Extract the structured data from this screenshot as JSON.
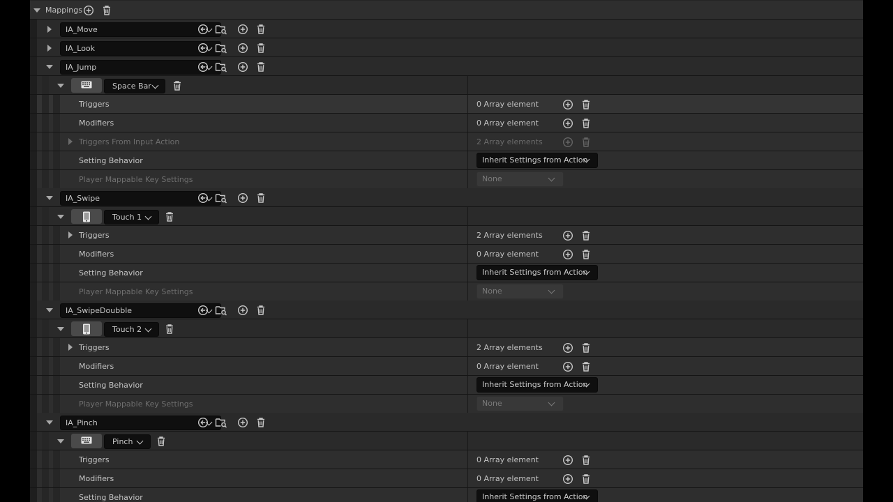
{
  "mappings": {
    "label": "Mappings"
  },
  "actions": [
    {
      "name": "IA_Move"
    },
    {
      "name": "IA_Look"
    },
    {
      "name": "IA_Jump"
    },
    {
      "name": "IA_Swipe"
    },
    {
      "name": "IA_SwipeDoubble"
    },
    {
      "name": "IA_Pinch"
    }
  ],
  "keys": {
    "jump": "Space Bar",
    "swipe": "Touch 1",
    "swipedouble": "Touch 2",
    "pinch": "Pinch"
  },
  "properties": {
    "triggers": "Triggers",
    "modifiers": "Modifiers",
    "triggers_from_action": "Triggers From Input Action",
    "setting_behavior": "Setting Behavior",
    "player_mappable": "Player Mappable Key Settings"
  },
  "values": {
    "zero_elements": "0 Array element",
    "two_elements": "2 Array elements",
    "inherit": "Inherit Settings from Action",
    "none": "None"
  },
  "icons": {
    "add": "add-icon",
    "delete": "trash-icon",
    "use_selected": "use-selected-arrow-icon",
    "browse": "browse-folder-icon",
    "keyboard": "keyboard-icon",
    "touch": "touch-device-icon"
  }
}
